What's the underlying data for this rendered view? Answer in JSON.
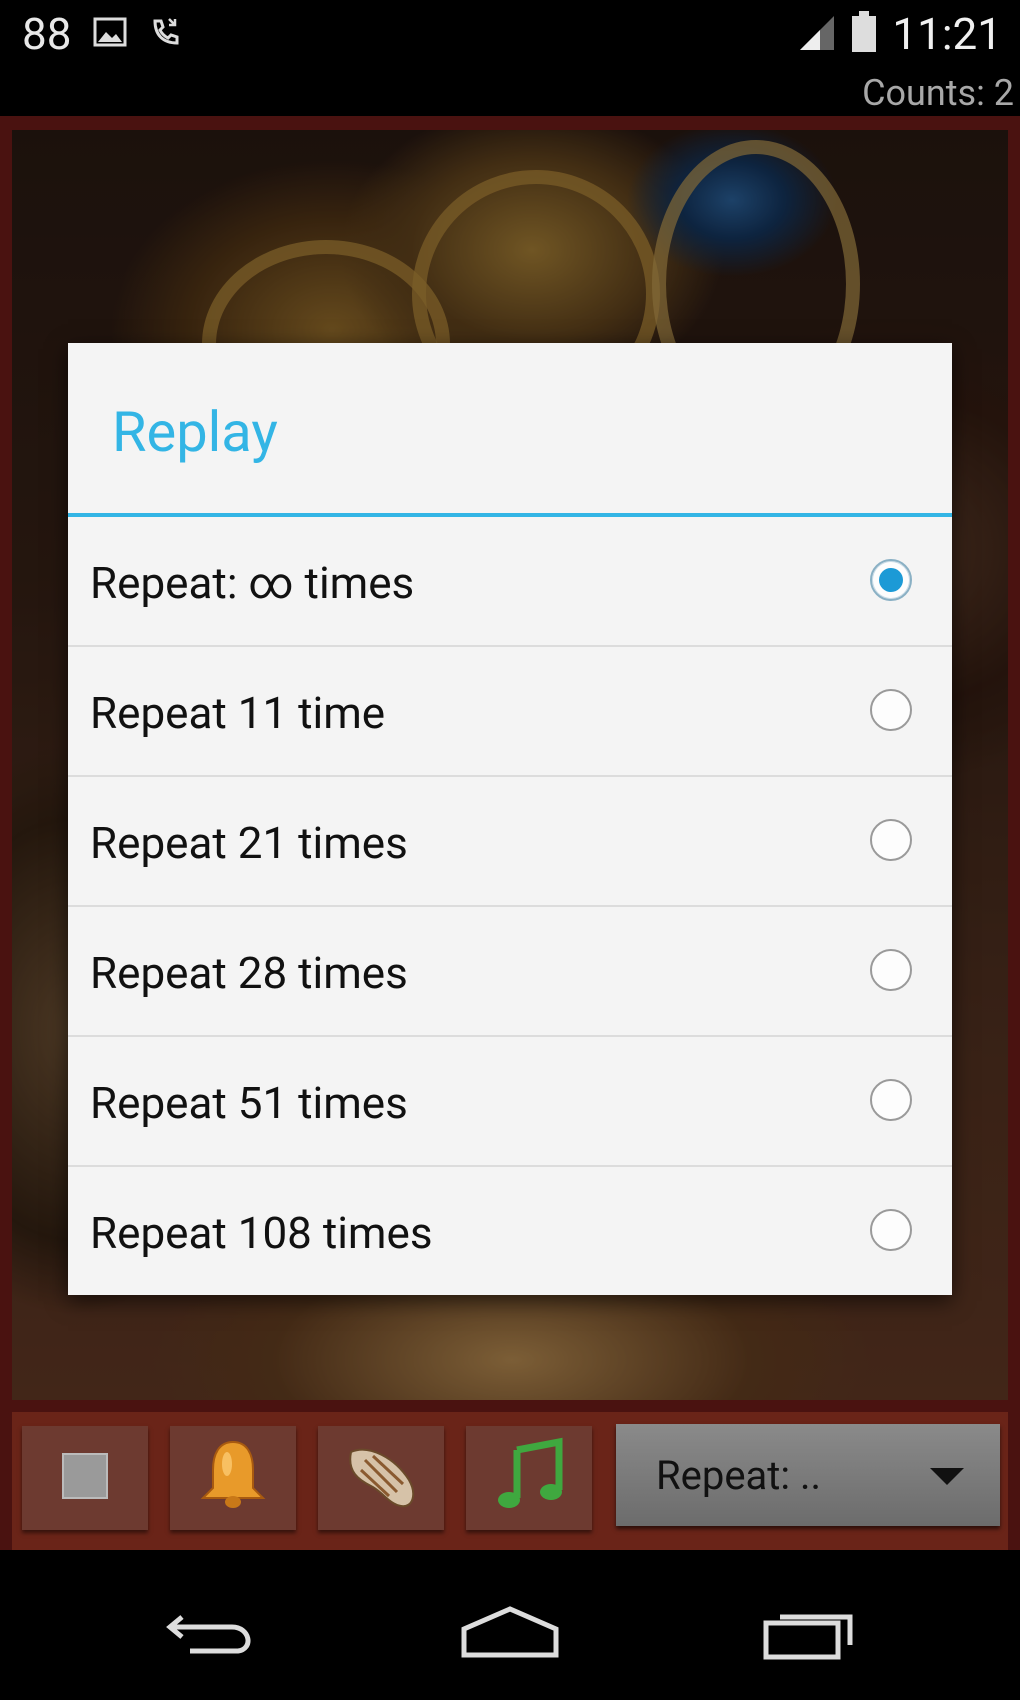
{
  "status_bar": {
    "notification_count": "88",
    "icons": [
      "image-icon",
      "missed-call-icon",
      "signal-icon",
      "battery-icon"
    ],
    "time": "11:21"
  },
  "counts_label": "Counts: 2",
  "toolbar": {
    "buttons": [
      "stop-icon",
      "bell-icon",
      "conch-shell-icon",
      "music-note-icon"
    ],
    "spinner_value": "Repeat: .."
  },
  "dialog": {
    "title": "Replay",
    "options": [
      {
        "label": "Repeat: ∞ times",
        "selected": true
      },
      {
        "label": "Repeat 11 time",
        "selected": false
      },
      {
        "label": "Repeat 21 times",
        "selected": false
      },
      {
        "label": "Repeat 28 times",
        "selected": false
      },
      {
        "label": "Repeat 51 times",
        "selected": false
      },
      {
        "label": "Repeat 108 times",
        "selected": false
      }
    ]
  },
  "nav": [
    "back-icon",
    "home-icon",
    "recent-apps-icon"
  ],
  "colors": {
    "accent": "#33b5e5",
    "radio_selected": "#1c9ad6",
    "frame": "#4a1210"
  }
}
